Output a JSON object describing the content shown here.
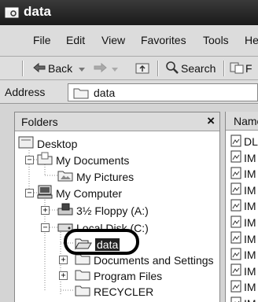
{
  "window": {
    "title": "data"
  },
  "menu": [
    "File",
    "Edit",
    "View",
    "Favorites",
    "Tools",
    "He"
  ],
  "toolbar": {
    "back_label": "Back",
    "search_label": "Search"
  },
  "address": {
    "label": "Address",
    "value": "data"
  },
  "folders": {
    "title": "Folders",
    "close": "×",
    "tree": [
      {
        "label": "Desktop"
      },
      {
        "label": "My Documents",
        "expander": "−"
      },
      {
        "label": "My Pictures"
      },
      {
        "label": "My Computer",
        "expander": "−"
      },
      {
        "label": "3½ Floppy (A:)",
        "expander": "+"
      },
      {
        "label": "Local Disk (C:)",
        "expander": "−"
      },
      {
        "label": "data",
        "selected": true
      },
      {
        "label": "Documents and Settings",
        "expander": "+"
      },
      {
        "label": "Program Files",
        "expander": "+"
      },
      {
        "label": "RECYCLER"
      }
    ]
  },
  "files": {
    "column_name": "Name",
    "rows": [
      "DL",
      "IM",
      "IM",
      "IM",
      "IM",
      "IM",
      "IM",
      "IM",
      "IM",
      "IM",
      "IM"
    ]
  }
}
